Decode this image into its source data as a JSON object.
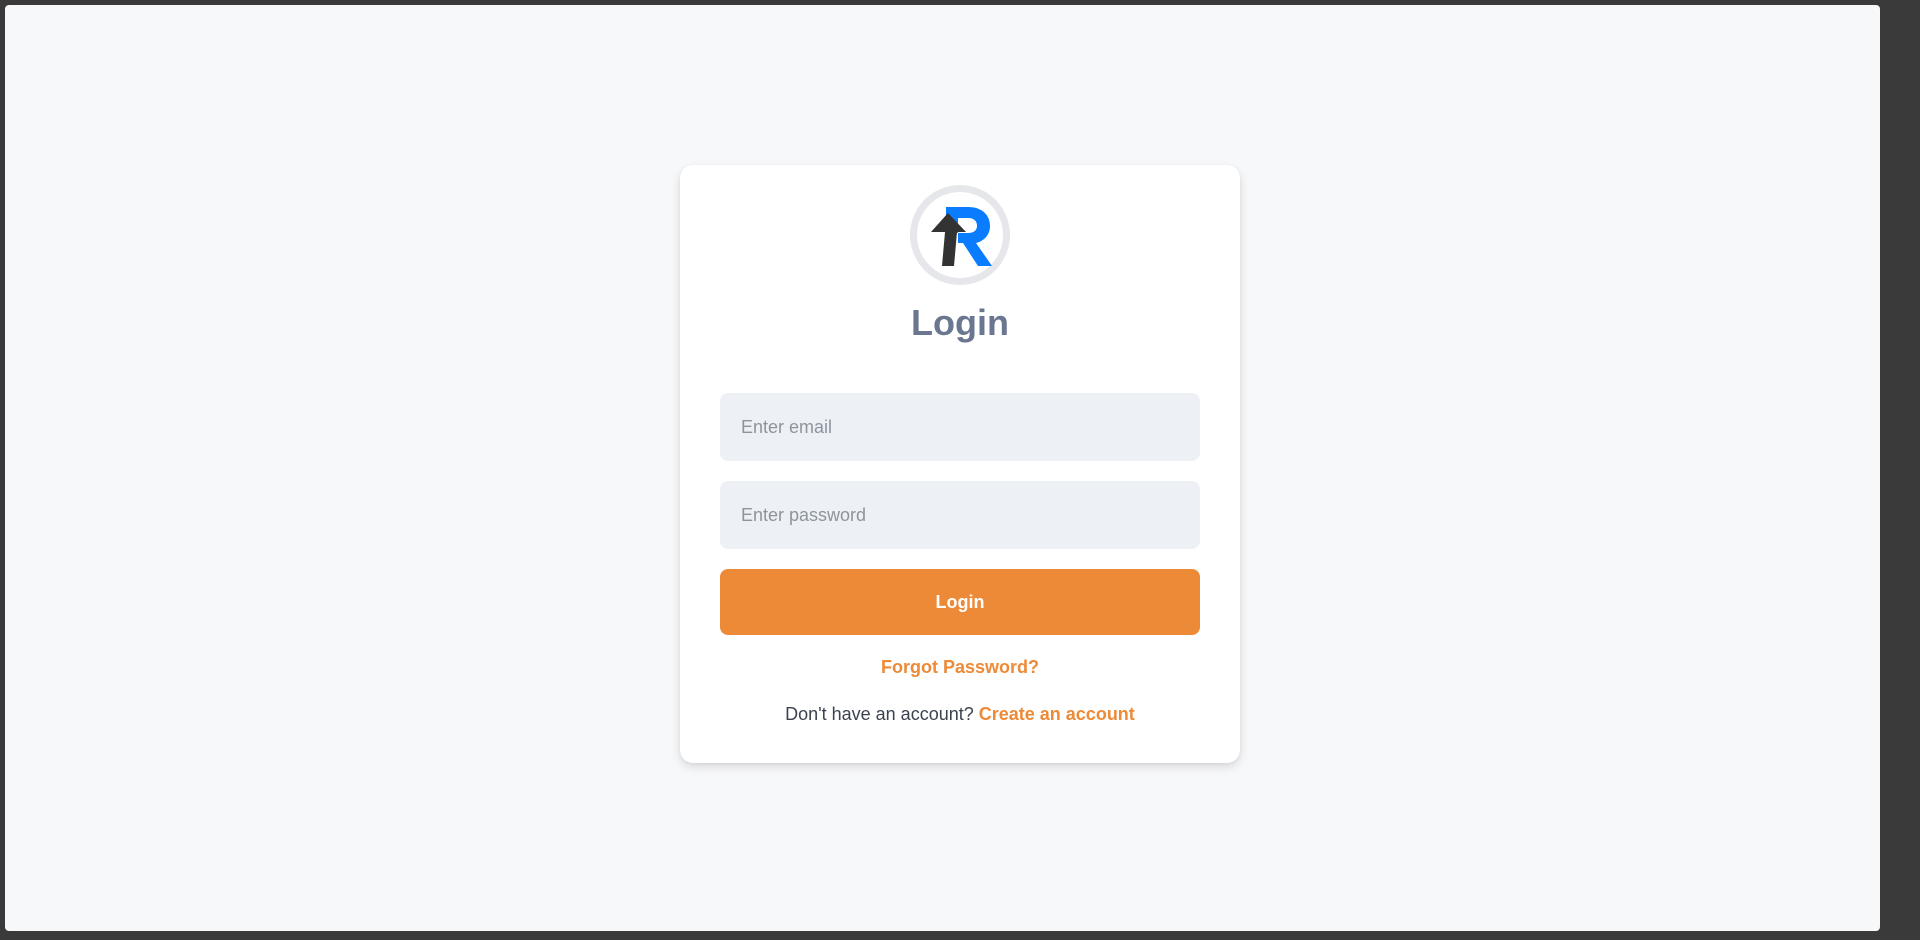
{
  "brand": {
    "logo_icon": "r-arrow-logo-icon",
    "primary_color": "#0a7cff",
    "arrow_color": "#333333"
  },
  "login": {
    "title": "Login",
    "email_placeholder": "Enter email",
    "password_placeholder": "Enter password",
    "submit_label": "Login",
    "forgot_password": "Forgot Password?",
    "signup_prompt": "Don't have an account?",
    "signup_link": "Create an account"
  },
  "colors": {
    "accent": "#ed8a37",
    "title": "#6b7791",
    "input_bg": "#edf1f5",
    "page_bg": "#f7f8fa"
  }
}
